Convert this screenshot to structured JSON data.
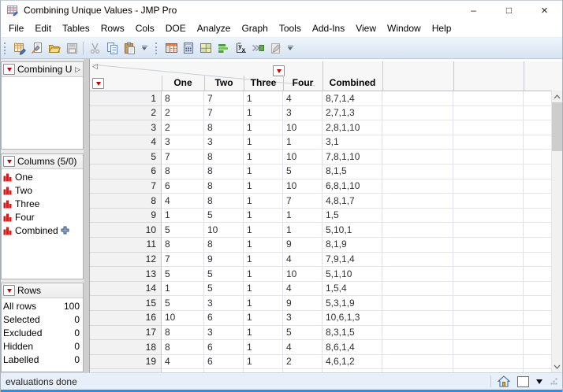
{
  "window": {
    "title": "Combining Unique Values - JMP Pro",
    "controls": {
      "minimize": "–",
      "maximize": "□",
      "close": "×"
    }
  },
  "menu": {
    "items": [
      "File",
      "Edit",
      "Tables",
      "Rows",
      "Cols",
      "DOE",
      "Analyze",
      "Graph",
      "Tools",
      "Add-Ins",
      "View",
      "Window",
      "Help"
    ]
  },
  "toolbar": {
    "groups": [
      {
        "buttons": [
          {
            "icon": "new-data-table-icon",
            "enabled": true
          },
          {
            "icon": "new-journal-icon",
            "enabled": true
          },
          {
            "icon": "open-folder-icon",
            "enabled": true
          },
          {
            "icon": "save-icon",
            "enabled": false
          },
          {
            "icon": "separator"
          },
          {
            "icon": "cut-icon",
            "enabled": false
          },
          {
            "icon": "copy-icon",
            "enabled": true
          },
          {
            "icon": "paste-icon",
            "enabled": true
          }
        ]
      },
      {
        "buttons": [
          {
            "icon": "data-table-icon",
            "enabled": true
          },
          {
            "icon": "formula-calculator-icon",
            "enabled": true
          },
          {
            "icon": "split-table-icon",
            "enabled": true
          },
          {
            "icon": "graph-builder-icon",
            "enabled": true
          },
          {
            "icon": "fit-y-by-x-icon",
            "enabled": true
          },
          {
            "icon": "join-tables-icon",
            "enabled": true
          },
          {
            "icon": "script-editor-icon",
            "enabled": false
          }
        ]
      }
    ]
  },
  "sidebar": {
    "table_panel": {
      "title": "Combining U...",
      "expand_glyph": "▷"
    },
    "columns_panel": {
      "title": "Columns (5/0)",
      "items": [
        {
          "label": "One",
          "icon": "continuous-column-icon"
        },
        {
          "label": "Two",
          "icon": "continuous-column-icon"
        },
        {
          "label": "Three",
          "icon": "continuous-column-icon"
        },
        {
          "label": "Four",
          "icon": "continuous-column-icon"
        },
        {
          "label": "Combined",
          "icon": "continuous-column-icon",
          "badge": "formula-plus-icon"
        }
      ]
    },
    "rows_panel": {
      "title": "Rows",
      "stats": [
        {
          "label": "All rows",
          "value": "100"
        },
        {
          "label": "Selected",
          "value": "0"
        },
        {
          "label": "Excluded",
          "value": "0"
        },
        {
          "label": "Hidden",
          "value": "0"
        },
        {
          "label": "Labelled",
          "value": "0"
        }
      ]
    }
  },
  "table": {
    "corner_collapse_glyph": "◁",
    "columns": [
      "One",
      "Two",
      "Three",
      "Four",
      "Combined"
    ],
    "rows": [
      [
        "1",
        "8",
        "7",
        "1",
        "4",
        "8,7,1,4"
      ],
      [
        "2",
        "2",
        "7",
        "1",
        "3",
        "2,7,1,3"
      ],
      [
        "3",
        "2",
        "8",
        "1",
        "10",
        "2,8,1,10"
      ],
      [
        "4",
        "3",
        "3",
        "1",
        "1",
        "3,1"
      ],
      [
        "5",
        "7",
        "8",
        "1",
        "10",
        "7,8,1,10"
      ],
      [
        "6",
        "8",
        "8",
        "1",
        "5",
        "8,1,5"
      ],
      [
        "7",
        "6",
        "8",
        "1",
        "10",
        "6,8,1,10"
      ],
      [
        "8",
        "4",
        "8",
        "1",
        "7",
        "4,8,1,7"
      ],
      [
        "9",
        "1",
        "5",
        "1",
        "1",
        "1,5"
      ],
      [
        "10",
        "5",
        "10",
        "1",
        "1",
        "5,10,1"
      ],
      [
        "11",
        "8",
        "8",
        "1",
        "9",
        "8,1,9"
      ],
      [
        "12",
        "7",
        "9",
        "1",
        "4",
        "7,9,1,4"
      ],
      [
        "13",
        "5",
        "5",
        "1",
        "10",
        "5,1,10"
      ],
      [
        "14",
        "1",
        "5",
        "1",
        "4",
        "1,5,4"
      ],
      [
        "15",
        "5",
        "3",
        "1",
        "9",
        "5,3,1,9"
      ],
      [
        "16",
        "10",
        "6",
        "1",
        "3",
        "10,6,1,3"
      ],
      [
        "17",
        "8",
        "3",
        "1",
        "5",
        "8,3,1,5"
      ],
      [
        "18",
        "8",
        "6",
        "1",
        "4",
        "8,6,1,4"
      ],
      [
        "19",
        "4",
        "6",
        "1",
        "2",
        "4,6,1,2"
      ]
    ]
  },
  "status": {
    "text": "evaluations done"
  }
}
